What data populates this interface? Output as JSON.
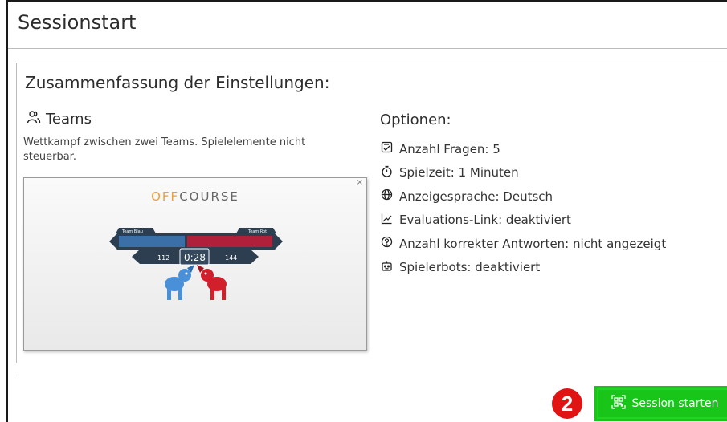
{
  "page": {
    "title": "Sessionstart"
  },
  "summary": {
    "heading": "Zusammenfassung der Einstellungen:",
    "mode": {
      "icon": "users-icon",
      "label": "Teams",
      "description": "Wettkampf zwischen zwei Teams. Spielelemente nicht steuerbar."
    },
    "preview": {
      "close_label": "×",
      "brand_part1": "OFF",
      "brand_part2": "COURSE",
      "team_left": "Team Blau",
      "team_right": "Team Rot",
      "score_left": "112",
      "timer": "0:28",
      "score_right": "144",
      "colors": {
        "blue": "#3a6fa8",
        "red": "#b0203a",
        "dark": "#2c3e50",
        "orange": "#f39c33"
      }
    },
    "options_title": "Optionen:",
    "options": [
      {
        "icon": "checklist-icon",
        "label": "Anzahl Fragen: 5"
      },
      {
        "icon": "stopwatch-icon",
        "label": "Spielzeit: 1 Minuten"
      },
      {
        "icon": "globe-icon",
        "label": "Anzeigesprache: Deutsch"
      },
      {
        "icon": "chart-line-icon",
        "label": "Evaluations-Link: deaktiviert"
      },
      {
        "icon": "question-icon",
        "label": "Anzahl korrekter Antworten: nicht angezeigt"
      },
      {
        "icon": "robot-icon",
        "label": "Spielerbots: deaktiviert"
      }
    ]
  },
  "footer": {
    "step_badge": "2",
    "start_button": {
      "icon": "qr-code-icon",
      "label": "Session starten",
      "color": "#18c518"
    },
    "badge_color": "#e11414"
  }
}
